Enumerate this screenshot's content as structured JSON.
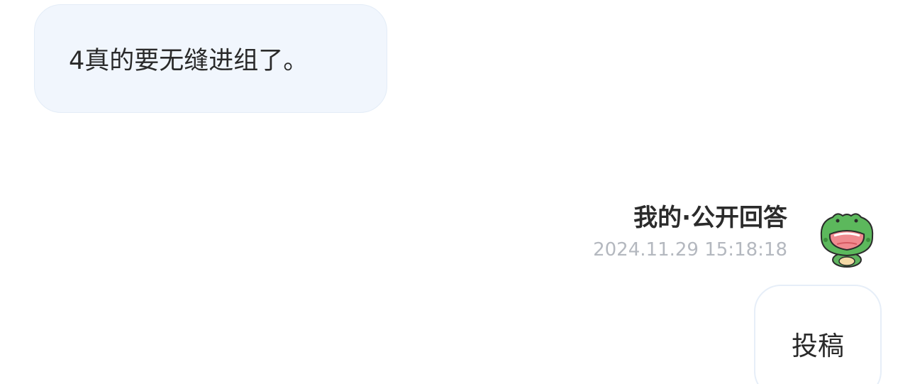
{
  "incoming_message": {
    "text": "4真的要无缝进组了。"
  },
  "reply": {
    "author_label": "我的·公开回答",
    "timestamp": "2024.11.29 15:18:18",
    "avatar_icon": "green-frog-avatar-icon",
    "text": "投稿"
  },
  "colors": {
    "incoming_bubble_bg": "#f1f6fd",
    "timestamp_text": "#b4b8bf",
    "avatar_green": "#4caf50"
  }
}
